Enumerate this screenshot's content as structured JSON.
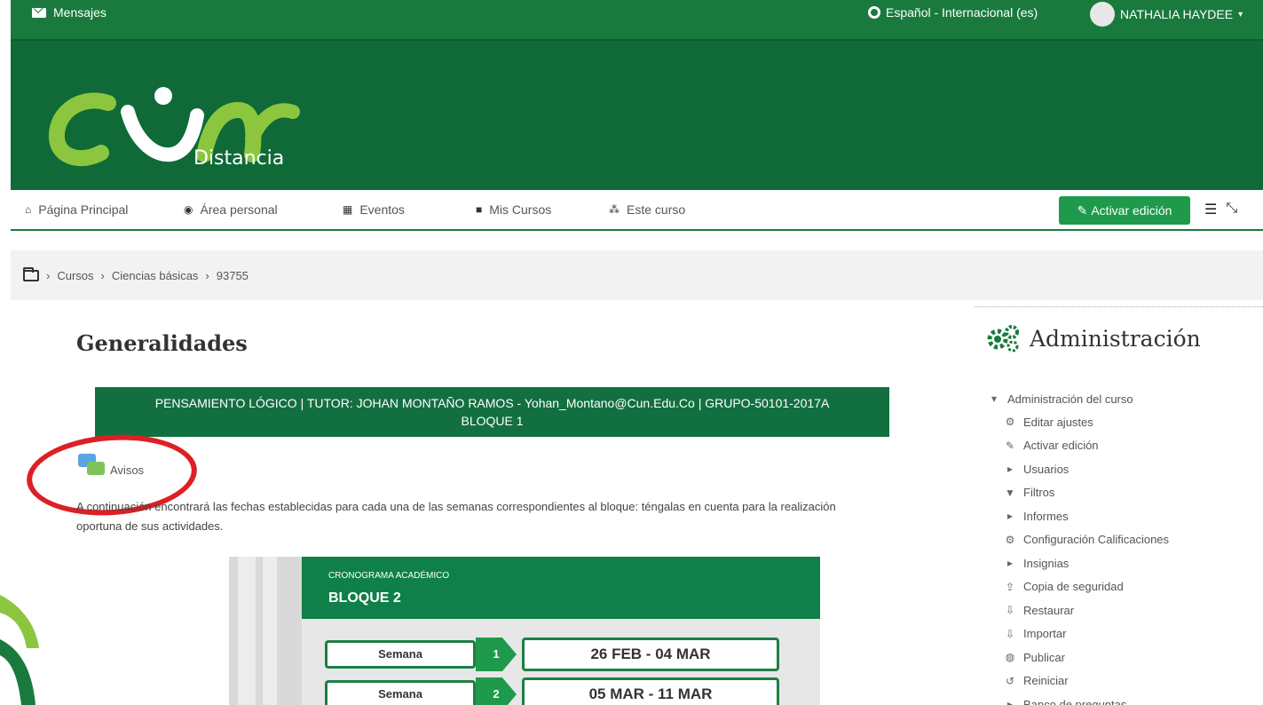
{
  "topbar": {
    "messages_label": "Mensajes",
    "language_label": "Español - Internacional (es)",
    "user_name": "NATHALIA HAYDEE"
  },
  "header": {
    "logo_text": "cun",
    "logo_sub": "Distancia"
  },
  "nav": {
    "items": [
      {
        "label": "Página Principal",
        "icon": "home-icon"
      },
      {
        "label": "Área personal",
        "icon": "dashboard-icon"
      },
      {
        "label": "Eventos",
        "icon": "calendar-icon"
      },
      {
        "label": "Mis Cursos",
        "icon": "briefcase-icon"
      },
      {
        "label": "Este curso",
        "icon": "sitemap-icon"
      }
    ],
    "edit_button": "Activar edición"
  },
  "breadcrumb": {
    "items": [
      "Cursos",
      "Ciencias básicas",
      "93755"
    ]
  },
  "main": {
    "title": "Generalidades",
    "banner_line1": "PENSAMIENTO LÓGICO | TUTOR: JOHAN MONTAÑO RAMOS - Yohan_Montano@Cun.Edu.Co | GRUPO-50101-2017A",
    "banner_line2": "BLOQUE 1",
    "avisos_label": "Avisos",
    "paragraph": "A continuación encontrará las fechas establecidas para cada una de las semanas correspondientes al bloque: téngalas en cuenta para la realización oportuna de sus actividades."
  },
  "schedule": {
    "subtitle": "CRONOGRAMA ACADÉMICO",
    "block": "BLOQUE 2",
    "weeks": [
      {
        "label": "Semana",
        "num": "1",
        "dates": "26 FEB - 04 MAR"
      },
      {
        "label": "Semana",
        "num": "2",
        "dates": "05 MAR - 11 MAR"
      }
    ]
  },
  "sidebar": {
    "title": "Administración",
    "root": "Administración del curso",
    "items": [
      {
        "label": "Editar ajustes",
        "icon": "gear-icon"
      },
      {
        "label": "Activar edición",
        "icon": "pencil-icon"
      },
      {
        "label": "Usuarios",
        "icon": "caret-right-icon"
      },
      {
        "label": "Filtros",
        "icon": "filter-icon"
      },
      {
        "label": "Informes",
        "icon": "caret-right-icon"
      },
      {
        "label": "Configuración Calificaciones",
        "icon": "gear-icon"
      },
      {
        "label": "Insignias",
        "icon": "caret-right-icon"
      },
      {
        "label": "Copia de seguridad",
        "icon": "upload-icon"
      },
      {
        "label": "Restaurar",
        "icon": "download-icon"
      },
      {
        "label": "Importar",
        "icon": "download-icon"
      },
      {
        "label": "Publicar",
        "icon": "share-icon"
      },
      {
        "label": "Reiniciar",
        "icon": "reset-icon"
      },
      {
        "label": "Banco de preguntas",
        "icon": "caret-right-icon"
      }
    ]
  },
  "colors": {
    "brand_green": "#1a7a3e",
    "header_green": "#0f6a38",
    "button_green": "#1f9a4c",
    "highlight_red": "#dd1f26"
  }
}
